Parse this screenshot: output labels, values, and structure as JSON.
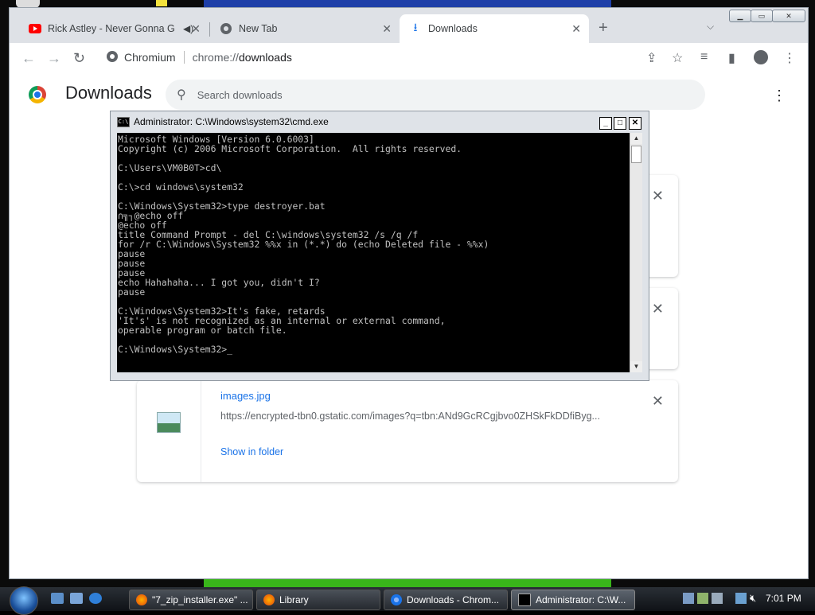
{
  "browser": {
    "tabs": [
      {
        "title": "Rick Astley - Never Gonna G",
        "icon": "youtube-icon",
        "muted_icon": "speaker-icon"
      },
      {
        "title": "New Tab",
        "icon": "chrome-icon"
      },
      {
        "title": "Downloads",
        "icon": "download-icon",
        "active": true
      }
    ],
    "new_tab_symbol": "+",
    "omnibox": {
      "site_label": "Chromium",
      "url_prefix": "chrome://",
      "url_path": "downloads"
    }
  },
  "downloads_page": {
    "title": "Downloads",
    "search_placeholder": "Search downloads",
    "items": [
      {
        "file_name": "images.jpg",
        "url": "https://encrypted-tbn0.gstatic.com/images?q=tbn:ANd9GcRCgjbvo0ZHSkFkDDfiByg...",
        "action": "Show in folder"
      }
    ]
  },
  "cmd": {
    "title": "Administrator: C:\\Windows\\system32\\cmd.exe",
    "lines": [
      "Microsoft Windows [Version 6.0.6003]",
      "Copyright (c) 2006 Microsoft Corporation.  All rights reserved.",
      "",
      "C:\\Users\\VM0B0T>cd\\",
      "",
      "C:\\>cd windows\\system32",
      "",
      "C:\\Windows\\System32>type destroyer.bat",
      "∩╗┐@echo off",
      "@echo off",
      "title Command Prompt - del C:\\windows\\system32 /s /q /f",
      "for /r C:\\Windows\\System32 %%x in (*.*) do (echo Deleted file - %%x)",
      "pause",
      "pause",
      "pause",
      "echo Hahahaha... I got you, didn't I?",
      "pause",
      "",
      "C:\\Windows\\System32>It's fake, retards",
      "'It's' is not recognized as an internal or external command,",
      "operable program or batch file.",
      "",
      "C:\\Windows\\System32>_"
    ]
  },
  "taskbar": {
    "buttons": [
      {
        "label": "\"7_zip_installer.exe\" ...",
        "icon": "firefox-icon"
      },
      {
        "label": "Library",
        "icon": "firefox-icon"
      },
      {
        "label": "Downloads - Chrom...",
        "icon": "chromium-icon"
      },
      {
        "label": "Administrator: C:\\W...",
        "icon": "cmd-icon",
        "active": true
      }
    ],
    "clock": "7:01 PM"
  }
}
